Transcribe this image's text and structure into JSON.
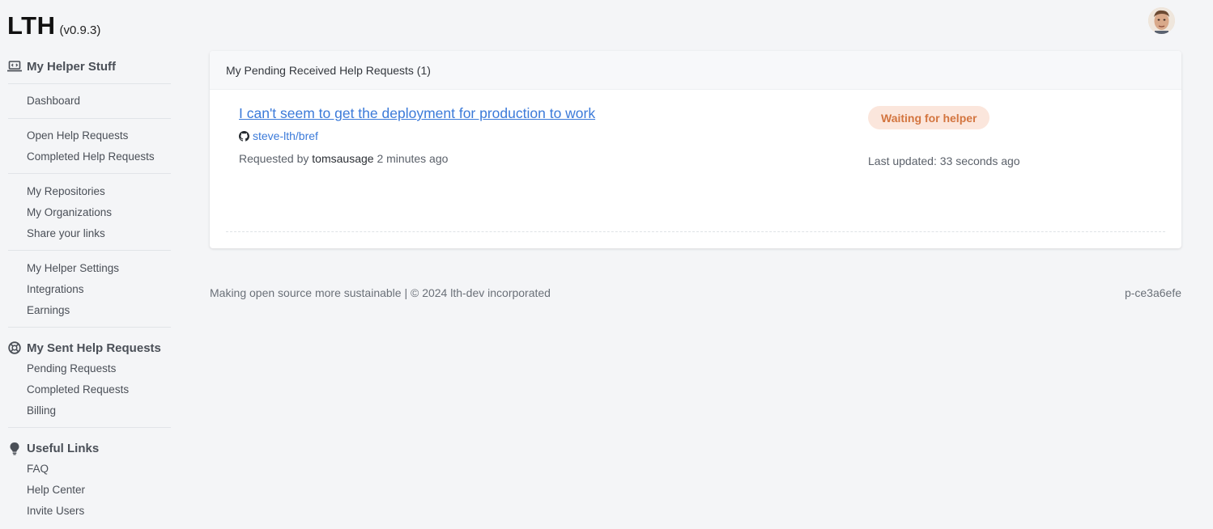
{
  "app": {
    "name": "LTH",
    "version": "(v0.9.3)"
  },
  "sidebar": {
    "helper": {
      "title": "My Helper Stuff",
      "icon": "laptop-code-icon",
      "groups": [
        [
          "Dashboard"
        ],
        [
          "Open Help Requests",
          "Completed Help Requests"
        ],
        [
          "My Repositories",
          "My Organizations",
          "Share your links"
        ],
        [
          "My Helper Settings",
          "Integrations",
          "Earnings"
        ]
      ]
    },
    "sent": {
      "title": "My Sent Help Requests",
      "icon": "lifebuoy-icon",
      "items": [
        "Pending Requests",
        "Completed Requests",
        "Billing"
      ]
    },
    "links": {
      "title": "Useful Links",
      "icon": "lightbulb-icon",
      "items": [
        "FAQ",
        "Help Center",
        "Invite Users"
      ]
    }
  },
  "main": {
    "card_title": "My Pending Received Help Requests (1)",
    "requests": [
      {
        "title": "I can't seem to get the deployment for production to work",
        "repo": "steve-lth/bref",
        "requested_prefix": "Requested by",
        "requester": "tomsausage",
        "requested_time": "2 minutes ago",
        "status": "Waiting for helper",
        "last_updated": "Last updated: 33 seconds ago"
      }
    ]
  },
  "footer": {
    "tagline": "Making open source more sustainable | © 2024 lth-dev incorporated",
    "build": "p-ce3a6efe"
  },
  "colors": {
    "link": "#3b7ad9",
    "badge_bg": "#fbe6dc",
    "badge_text": "#d3753f",
    "page_bg": "#f4f5f7"
  }
}
